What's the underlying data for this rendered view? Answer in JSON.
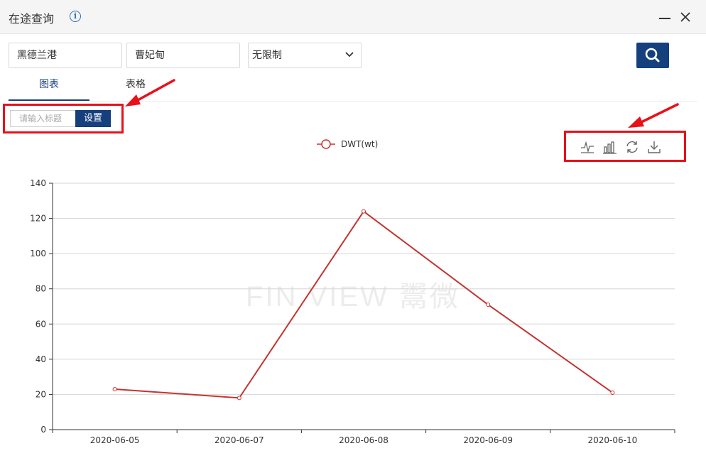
{
  "window": {
    "title": "在途查询",
    "info_icon": "i"
  },
  "filters": {
    "port_value": "黑德兰港",
    "ship_value": "曹妃甸",
    "limit_value": "无限制"
  },
  "tabs": [
    {
      "label": "图表",
      "active": true
    },
    {
      "label": "表格",
      "active": false
    }
  ],
  "chart_title_setting": {
    "placeholder": "请输入标题",
    "button_label": "设置"
  },
  "toolbox": [
    "line-chart-icon",
    "bar-chart-icon",
    "restore-icon",
    "download-icon"
  ],
  "watermark": "FIN VIEW 鬻微",
  "colors": {
    "accent": "#163f7d",
    "series": "#c23531",
    "annotation": "#e8111a"
  },
  "chart_data": {
    "type": "line",
    "categories": [
      "2020-06-05",
      "2020-06-07",
      "2020-06-08",
      "2020-06-09",
      "2020-06-10"
    ],
    "series": [
      {
        "name": "DWT(wt)",
        "values": [
          23,
          18,
          124,
          71,
          21
        ]
      }
    ],
    "yticks": [
      "0",
      "20",
      "40",
      "60",
      "80",
      "100",
      "120",
      "140"
    ],
    "ylim": [
      0,
      140
    ],
    "grid": true,
    "legend_position": "top-center"
  }
}
